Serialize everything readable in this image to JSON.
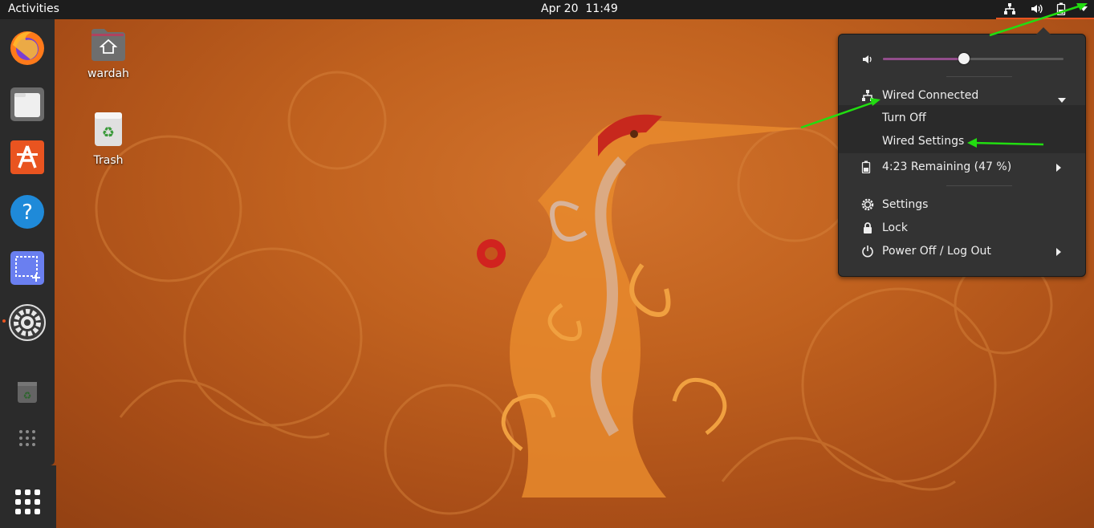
{
  "topbar": {
    "activities": "Activities",
    "date": "Apr 20",
    "time": "11:49",
    "icons": [
      "network-wired-icon",
      "volume-icon",
      "battery-icon",
      "dropdown-icon"
    ]
  },
  "dock": {
    "apps": [
      "firefox",
      "files",
      "ubuntu-software",
      "help",
      "screenshot",
      "settings",
      "trash"
    ],
    "show_apps_icon": "grid-icon"
  },
  "desktop": {
    "home_label": "wardah",
    "trash_label": "Trash"
  },
  "menu": {
    "volume_level": 0.45,
    "network_label": "Wired Connected",
    "turn_off": "Turn Off",
    "wired_settings": "Wired Settings",
    "battery_label": "4:23 Remaining (47 %)",
    "settings": "Settings",
    "lock": "Lock",
    "power": "Power Off / Log Out"
  },
  "colors": {
    "accent": "#e95420",
    "panel": "#1d1d1d",
    "menu_bg": "#333333",
    "annotation_arrow": "#22dd11"
  }
}
